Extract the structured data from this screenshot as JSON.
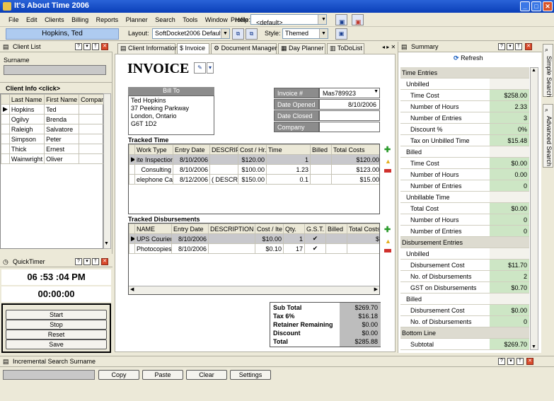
{
  "app": {
    "title": "It's About Time 2006"
  },
  "menu": [
    "File",
    "Edit",
    "Clients",
    "Billing",
    "Reports",
    "Planner",
    "Search",
    "Tools",
    "Window",
    "Help"
  ],
  "profile": {
    "label": "Profile:",
    "value": "<default>"
  },
  "client_banner": "Hopkins, Ted",
  "layout": {
    "label": "Layout:",
    "value": "SoftDocket2006 Default",
    "style_label": "Style:",
    "style_value": "Themed"
  },
  "client_list": {
    "title": "Client List",
    "surname_label": "Surname",
    "info_title": "Client Info <click>",
    "columns": [
      "Last Name",
      "First Name",
      "Company"
    ],
    "rows": [
      {
        "last": "Hopkins",
        "first": "Ted",
        "company": ""
      },
      {
        "last": "Ogilvy",
        "first": "Brenda",
        "company": ""
      },
      {
        "last": "Raleigh",
        "first": "Salvatore",
        "company": ""
      },
      {
        "last": "Simpson",
        "first": "Peter",
        "company": ""
      },
      {
        "last": "Thick",
        "first": "Ernest",
        "company": ""
      },
      {
        "last": "Wainwright",
        "first": "Oliver",
        "company": ""
      }
    ]
  },
  "quicktimer": {
    "title": "QuickTimer",
    "clock": "06 :53 :04 PM",
    "elapsed": "00:00:00",
    "buttons": [
      "Start",
      "Stop",
      "Reset",
      "Save"
    ]
  },
  "tabs": [
    "Client Information",
    "Invoice",
    "Document Manager",
    "Day Planner",
    "ToDoList"
  ],
  "invoice": {
    "heading": "INVOICE",
    "bill_to_label": "Bill To",
    "bill_to": [
      "Ted Hopkins",
      "37 Peeking Parkway",
      "London, Ontario",
      "G6T 1D2"
    ],
    "fields": [
      {
        "label": "Invoice #",
        "value": "Mas789923"
      },
      {
        "label": "Date Opened",
        "value": "8/10/2006"
      },
      {
        "label": "Date Closed",
        "value": ""
      },
      {
        "label": "Company",
        "value": ""
      }
    ],
    "tracked_time_title": "Tracked Time",
    "time_columns": [
      "Work Type",
      "Entry Date",
      "DESCRIP",
      "Cost / Hr.",
      "Time",
      "Billed",
      "Total Costs"
    ],
    "time_rows": [
      {
        "type": "ite Inspection",
        "date": "8/10/2006",
        "desc": "",
        "cost": "$120.00",
        "time": "1",
        "billed": "",
        "total": "$120.00"
      },
      {
        "type": "Consulting",
        "date": "8/10/2006",
        "desc": "",
        "cost": "$100.00",
        "time": "1.23",
        "billed": "",
        "total": "$123.00"
      },
      {
        "type": "elephone Call",
        "date": "8/12/2006",
        "desc": "( DESCRII",
        "cost": "$150.00",
        "time": "0.1",
        "billed": "",
        "total": "$15.00"
      }
    ],
    "disb_title": "Tracked Disbursements",
    "disb_columns": [
      "NAME",
      "Entry Date",
      "DESCRIPTION",
      "Cost / Ite",
      "Qty.",
      "G.S.T.",
      "Billed",
      "Total Costs"
    ],
    "disb_rows": [
      {
        "name": "UPS Courier",
        "date": "8/10/2006",
        "desc": "",
        "cost": "$10.00",
        "qty": "1",
        "gst": "✔",
        "billed": "",
        "total": "$"
      },
      {
        "name": "Photocopies",
        "date": "8/10/2006",
        "desc": "",
        "cost": "$0.10",
        "qty": "17",
        "gst": "✔",
        "billed": "",
        "total": ""
      }
    ],
    "totals": [
      {
        "label": "Sub Total",
        "value": "$269.70"
      },
      {
        "label": "Tax  6%",
        "value": "$16.18"
      },
      {
        "label": "Retainer Remaining",
        "value": "$0.00"
      },
      {
        "label": "Discount",
        "value": "$0.00"
      },
      {
        "label": "Total",
        "value": "$285.88"
      }
    ]
  },
  "summary": {
    "title": "Summary",
    "refresh": "Refresh",
    "rows": [
      {
        "label": "Time Entries",
        "value": null,
        "level": 0
      },
      {
        "label": "Unbilled",
        "value": null,
        "level": 1
      },
      {
        "label": "Time Cost",
        "value": "$258.00",
        "level": 2
      },
      {
        "label": "Number of Hours",
        "value": "2.33",
        "level": 2
      },
      {
        "label": "Number of Entries",
        "value": "3",
        "level": 2
      },
      {
        "label": "Discount %",
        "value": "0%",
        "level": 2
      },
      {
        "label": "Tax on Unbilled Time",
        "value": "$15.48",
        "level": 2
      },
      {
        "label": "Billed",
        "value": null,
        "level": 1
      },
      {
        "label": "Time Cost",
        "value": "$0.00",
        "level": 2
      },
      {
        "label": "Number of Hours",
        "value": "0.00",
        "level": 2
      },
      {
        "label": "Number of Entries",
        "value": "0",
        "level": 2
      },
      {
        "label": "Unbillable Time",
        "value": null,
        "level": 1
      },
      {
        "label": "Total Cost",
        "value": "$0.00",
        "level": 2
      },
      {
        "label": "Number of Hours",
        "value": "0",
        "level": 2
      },
      {
        "label": "Number of Entries",
        "value": "0",
        "level": 2
      },
      {
        "label": "Disbursement Entries",
        "value": null,
        "level": 0
      },
      {
        "label": "Unbilled",
        "value": null,
        "level": 1
      },
      {
        "label": "Disbursement Cost",
        "value": "$11.70",
        "level": 2
      },
      {
        "label": "No. of Disbursements",
        "value": "2",
        "level": 2
      },
      {
        "label": "GST on Disbursements",
        "value": "$0.70",
        "level": 2
      },
      {
        "label": "Billed",
        "value": null,
        "level": 1
      },
      {
        "label": "Disbursement Cost",
        "value": "$0.00",
        "level": 2
      },
      {
        "label": "No. of Disbursements",
        "value": "0",
        "level": 2
      },
      {
        "label": "Bottom Line",
        "value": null,
        "level": 0
      },
      {
        "label": "Subtotal",
        "value": "$269.70",
        "level": 2
      }
    ]
  },
  "side_tabs": [
    "Simple Search",
    "Advanced Search"
  ],
  "incremental": {
    "title": "Incremental Search Surname",
    "buttons": [
      "Copy",
      "Paste",
      "Clear",
      "Settings"
    ]
  },
  "colors": {
    "title_bar": "#0a3fb8",
    "banner": "#aecbf0",
    "summary_value": "#cde6c5"
  }
}
